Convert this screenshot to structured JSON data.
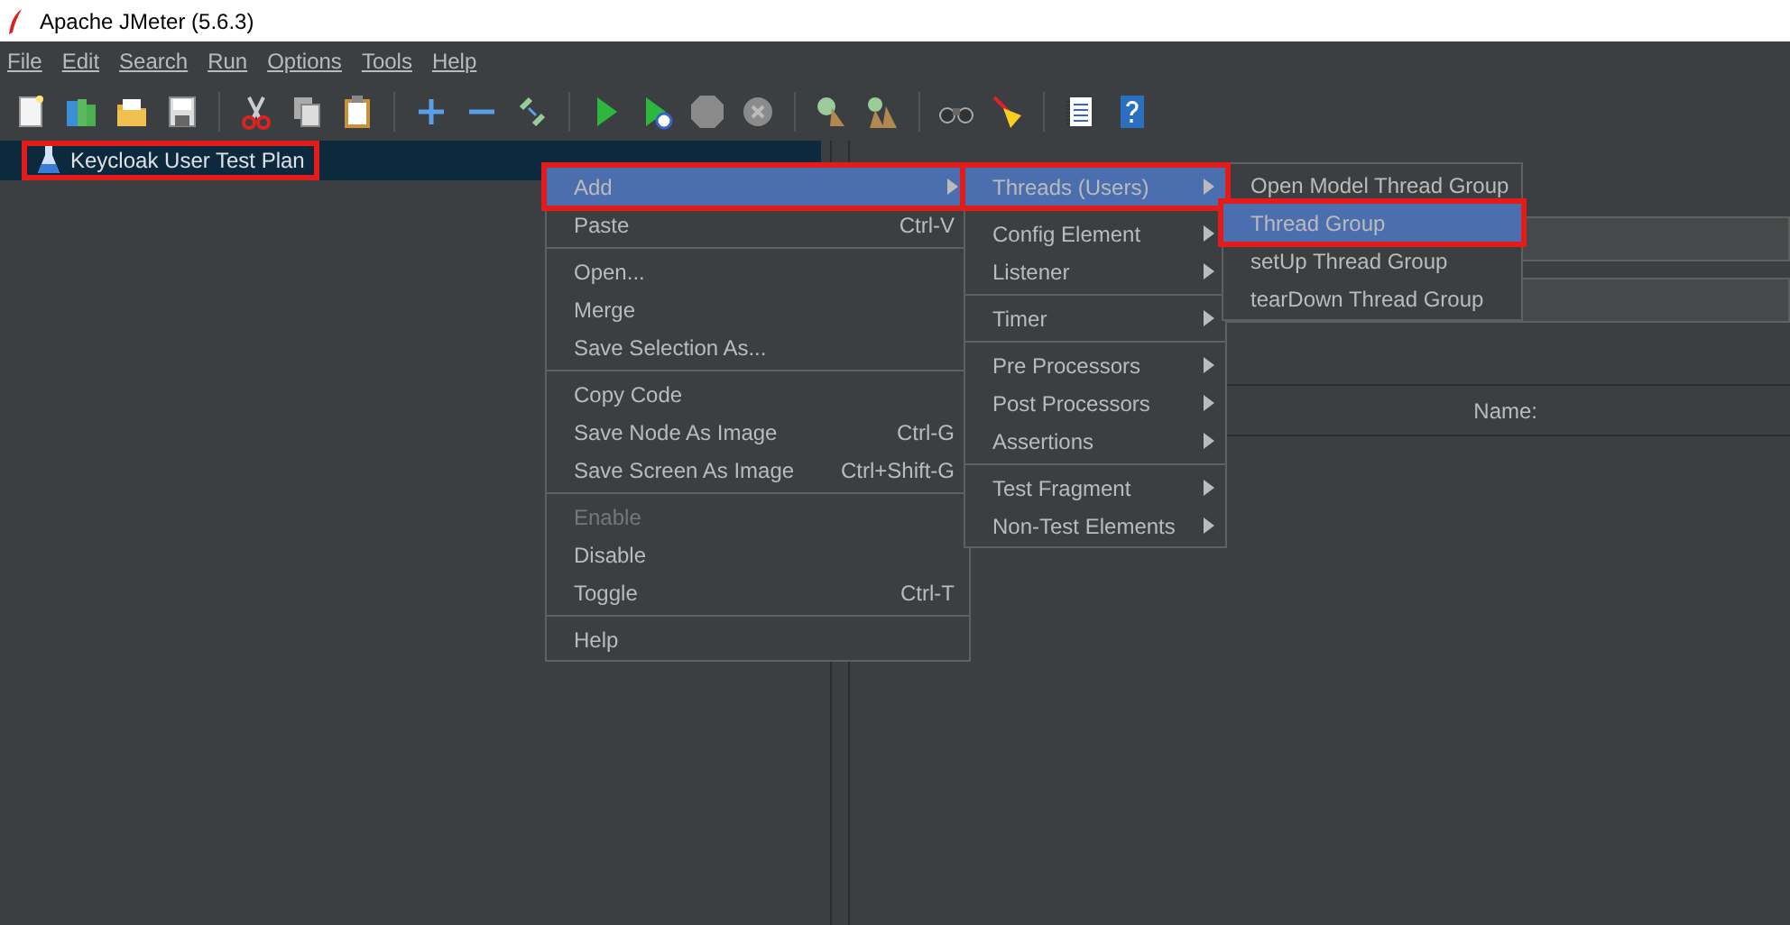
{
  "window": {
    "title": "Apache JMeter (5.6.3)"
  },
  "menubar": [
    {
      "label": "File"
    },
    {
      "label": "Edit"
    },
    {
      "label": "Search"
    },
    {
      "label": "Run"
    },
    {
      "label": "Options"
    },
    {
      "label": "Tools"
    },
    {
      "label": "Help"
    }
  ],
  "tree": [
    {
      "label": "Keycloak User Test Plan",
      "selected": true,
      "highlighted": true
    }
  ],
  "table": {
    "columns": [
      "Name:"
    ]
  },
  "context_menu": {
    "groups": [
      [
        {
          "label": "Add",
          "submenu": true,
          "selected": true,
          "highlighted": true,
          "disabled": false
        },
        {
          "label": "Paste",
          "shortcut": "Ctrl-V",
          "submenu": false,
          "selected": false,
          "highlighted": false,
          "disabled": false
        }
      ],
      [
        {
          "label": "Open...",
          "submenu": false,
          "selected": false,
          "highlighted": false,
          "disabled": false
        },
        {
          "label": "Merge",
          "submenu": false,
          "selected": false,
          "highlighted": false,
          "disabled": false
        },
        {
          "label": "Save Selection As...",
          "submenu": false,
          "selected": false,
          "highlighted": false,
          "disabled": false
        }
      ],
      [
        {
          "label": "Copy Code",
          "submenu": false,
          "selected": false,
          "highlighted": false,
          "disabled": false
        },
        {
          "label": "Save Node As Image",
          "shortcut": "Ctrl-G",
          "submenu": false,
          "selected": false,
          "highlighted": false,
          "disabled": false
        },
        {
          "label": "Save Screen As Image",
          "shortcut": "Ctrl+Shift-G",
          "submenu": false,
          "selected": false,
          "highlighted": false,
          "disabled": false
        }
      ],
      [
        {
          "label": "Enable",
          "submenu": false,
          "selected": false,
          "highlighted": false,
          "disabled": true
        },
        {
          "label": "Disable",
          "submenu": false,
          "selected": false,
          "highlighted": false,
          "disabled": false
        },
        {
          "label": "Toggle",
          "shortcut": "Ctrl-T",
          "submenu": false,
          "selected": false,
          "highlighted": false,
          "disabled": false
        }
      ],
      [
        {
          "label": "Help",
          "submenu": false,
          "selected": false,
          "highlighted": false,
          "disabled": false
        }
      ]
    ]
  },
  "add_submenu": {
    "groups": [
      [
        {
          "label": "Threads (Users)",
          "submenu": true,
          "selected": true,
          "highlighted": true,
          "disabled": false
        }
      ],
      [
        {
          "label": "Config Element",
          "submenu": true,
          "selected": false,
          "highlighted": false,
          "disabled": false
        },
        {
          "label": "Listener",
          "submenu": true,
          "selected": false,
          "highlighted": false,
          "disabled": false
        }
      ],
      [
        {
          "label": "Timer",
          "submenu": true,
          "selected": false,
          "highlighted": false,
          "disabled": false
        }
      ],
      [
        {
          "label": "Pre Processors",
          "submenu": true,
          "selected": false,
          "highlighted": false,
          "disabled": false
        },
        {
          "label": "Post Processors",
          "submenu": true,
          "selected": false,
          "highlighted": false,
          "disabled": false
        },
        {
          "label": "Assertions",
          "submenu": true,
          "selected": false,
          "highlighted": false,
          "disabled": false
        }
      ],
      [
        {
          "label": "Test Fragment",
          "submenu": true,
          "selected": false,
          "highlighted": false,
          "disabled": false
        },
        {
          "label": "Non-Test Elements",
          "submenu": true,
          "selected": false,
          "highlighted": false,
          "disabled": false
        }
      ]
    ]
  },
  "threads_submenu": {
    "groups": [
      [
        {
          "label": "Open Model Thread Group",
          "submenu": false,
          "selected": false,
          "highlighted": false,
          "disabled": false
        },
        {
          "label": "Thread Group",
          "submenu": false,
          "selected": true,
          "highlighted": true,
          "disabled": false
        },
        {
          "label": "setUp Thread Group",
          "submenu": false,
          "selected": false,
          "highlighted": false,
          "disabled": false
        },
        {
          "label": "tearDown Thread Group",
          "submenu": false,
          "selected": false,
          "highlighted": false,
          "disabled": false
        }
      ]
    ]
  }
}
